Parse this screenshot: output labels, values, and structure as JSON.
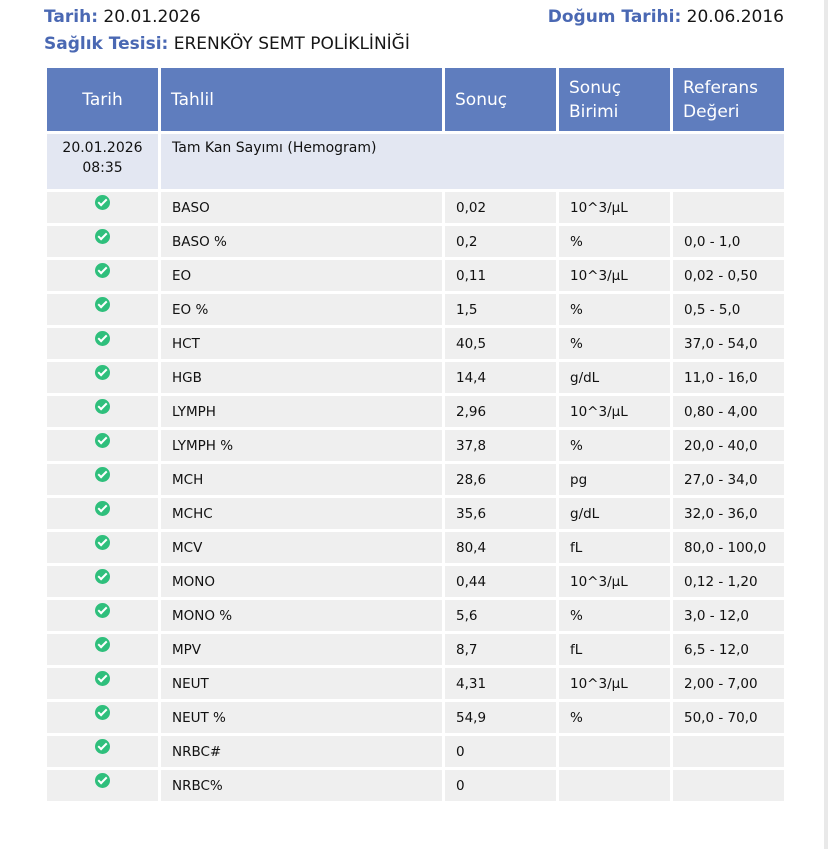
{
  "header": {
    "date_label": "Tarih:",
    "date_value": "20.01.2026",
    "birth_label": "Doğum Tarihi:",
    "birth_value": "20.06.2016",
    "facility_label": "Sağlık Tesisi:",
    "facility_value": "ERENKÖY SEMT POLİKLİNİĞİ"
  },
  "table": {
    "columns": [
      "Tarih",
      "Tahlil",
      "Sonuç",
      "Sonuç\nBirimi",
      "Referans\nDeğeri"
    ],
    "group": {
      "date": "20.01.2026",
      "time": "08:35",
      "name": "Tam Kan Sayımı (Hemogram)"
    },
    "rows": [
      {
        "test": "BASO",
        "result": "0,02",
        "unit": "10^3/µL",
        "ref": ""
      },
      {
        "test": "BASO %",
        "result": "0,2",
        "unit": "%",
        "ref": "0,0 - 1,0"
      },
      {
        "test": "EO",
        "result": "0,11",
        "unit": "10^3/µL",
        "ref": "0,02 - 0,50"
      },
      {
        "test": "EO %",
        "result": "1,5",
        "unit": "%",
        "ref": "0,5 - 5,0"
      },
      {
        "test": "HCT",
        "result": "40,5",
        "unit": "%",
        "ref": "37,0 - 54,0"
      },
      {
        "test": "HGB",
        "result": "14,4",
        "unit": "g/dL",
        "ref": "11,0 - 16,0"
      },
      {
        "test": "LYMPH",
        "result": "2,96",
        "unit": "10^3/µL",
        "ref": "0,80 - 4,00"
      },
      {
        "test": "LYMPH %",
        "result": "37,8",
        "unit": "%",
        "ref": "20,0 - 40,0"
      },
      {
        "test": "MCH",
        "result": "28,6",
        "unit": "pg",
        "ref": "27,0 - 34,0"
      },
      {
        "test": "MCHC",
        "result": "35,6",
        "unit": "g/dL",
        "ref": "32,0 - 36,0"
      },
      {
        "test": "MCV",
        "result": "80,4",
        "unit": "fL",
        "ref": "80,0 - 100,0"
      },
      {
        "test": "MONO",
        "result": "0,44",
        "unit": "10^3/µL",
        "ref": "0,12 - 1,20"
      },
      {
        "test": "MONO %",
        "result": "5,6",
        "unit": "%",
        "ref": "3,0 - 12,0"
      },
      {
        "test": "MPV",
        "result": "8,7",
        "unit": "fL",
        "ref": "6,5 - 12,0"
      },
      {
        "test": "NEUT",
        "result": "4,31",
        "unit": "10^3/µL",
        "ref": "2,00 - 7,00"
      },
      {
        "test": "NEUT %",
        "result": "54,9",
        "unit": "%",
        "ref": "50,0 - 70,0"
      },
      {
        "test": "NRBC#",
        "result": "0",
        "unit": "",
        "ref": ""
      },
      {
        "test": "NRBC%",
        "result": "0",
        "unit": "",
        "ref": ""
      }
    ]
  },
  "colors": {
    "accent": "#4a68b3",
    "header_bg": "#5f7dbe",
    "group_bg": "#e3e7f2",
    "row_bg": "#efefef",
    "status_ok": "#2fbf7c"
  },
  "icons": {
    "status": "check-circle-icon"
  }
}
